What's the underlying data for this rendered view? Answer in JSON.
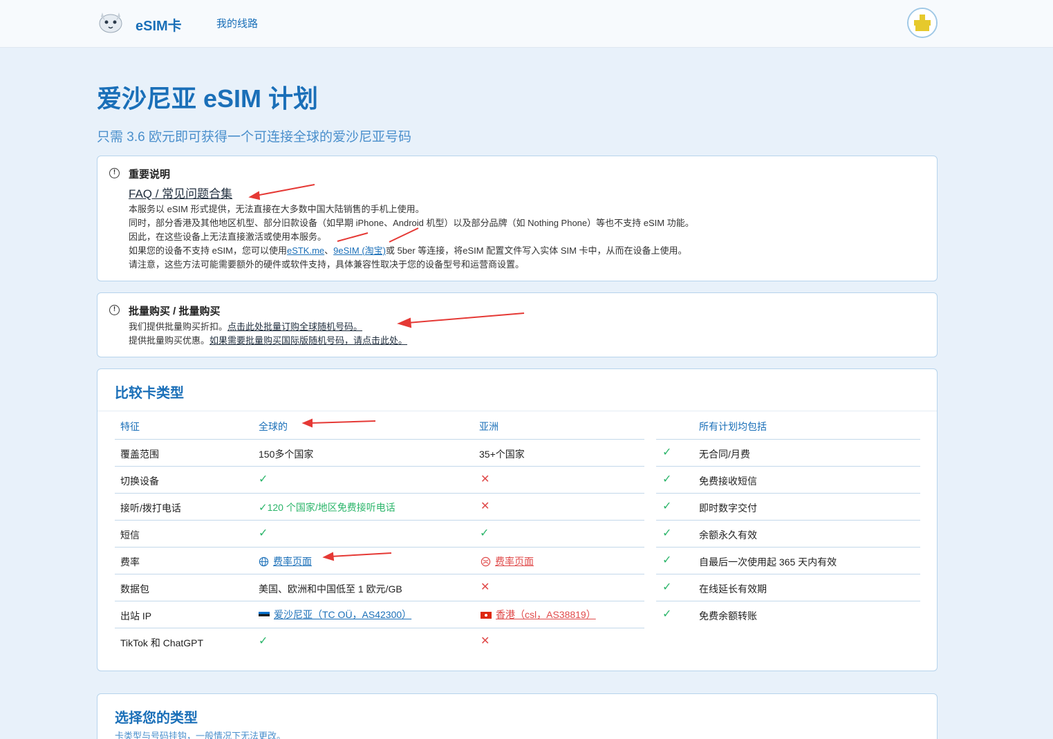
{
  "nav": {
    "brand": "eSIM卡",
    "link_my_lines": "我的线路"
  },
  "page": {
    "title": "爱沙尼亚 eSIM 计划",
    "subtitle": "只需 3.6 欧元即可获得一个可连接全球的爱沙尼亚号码"
  },
  "notice1": {
    "title": "重要说明",
    "faq": "FAQ / 常见问题合集",
    "line1": "本服务以 eSIM 形式提供，无法直接在大多数中国大陆销售的手机上使用。",
    "line2": "同时，部分香港及其他地区机型、部分旧款设备（如早期 iPhone、Android 机型）以及部分品牌（如 Nothing Phone）等也不支持 eSIM 功能。",
    "line3": "因此，在这些设备上无法直接激活或使用本服务。",
    "line4_pre": "如果您的设备不支持 eSIM，您可以使用",
    "line4_link1": "eSTK.me",
    "line4_sep": "、",
    "line4_link2": "9eSIM (淘宝)",
    "line4_post": "或 5ber 等连接，将eSIM 配置文件写入实体 SIM 卡中，从而在设备上使用。",
    "line5": "请注意，这些方法可能需要额外的硬件或软件支持，具体兼容性取决于您的设备型号和运营商设置。"
  },
  "notice2": {
    "title": "批量购买 / 批量购买",
    "line1_pre": "我们提供批量购买折扣。",
    "line1_link": "点击此处批量订购全球随机号码。",
    "line2_pre": "提供批量购买优惠。",
    "line2_link": "如果需要批量购买国际版随机号码，请点击此处。"
  },
  "compare": {
    "title": "比较卡类型",
    "headers": {
      "feature": "特征",
      "global": "全球的",
      "asia": "亚洲",
      "included": "所有计划均包括"
    },
    "rows": [
      {
        "feature": "覆盖范围",
        "global": "150多个国家",
        "asia": "35+个国家"
      },
      {
        "feature": "切换设备",
        "global": "check",
        "asia": "cross"
      },
      {
        "feature": "接听/拨打电话",
        "global": "120 个国家/地区免费接听电话",
        "asia": "cross"
      },
      {
        "feature": "短信",
        "global": "check",
        "asia": "check"
      },
      {
        "feature": "费率",
        "global": "费率页面",
        "asia": "费率页面"
      },
      {
        "feature": "数据包",
        "global": "美国、欧洲和中国低至 1 欧元/GB",
        "asia": "cross"
      },
      {
        "feature": "出站 IP",
        "global": "爱沙尼亚（TC OÜ，AS42300）",
        "asia": "香港（csl，AS38819）"
      },
      {
        "feature": "TikTok 和 ChatGPT",
        "global": "check",
        "asia": "cross"
      }
    ],
    "included": [
      "无合同/月费",
      "免费接收短信",
      "即时数字交付",
      "余额永久有效",
      "自最后一次使用起 365 天内有效",
      "在线延长有效期",
      "免费余额转账"
    ]
  },
  "choose": {
    "title": "选择您的类型",
    "subtitle": "卡类型与号码挂钩，一般情况下无法更改。"
  },
  "colors": {
    "primary": "#1a6fb8",
    "background": "#e8f1fa",
    "check": "#2bb56a",
    "cross": "#e04a4a",
    "annotation": "#e53935"
  },
  "icons": [
    "logo-icon",
    "avatar-icon",
    "info-icon",
    "check-icon",
    "cross-icon",
    "globe-icon",
    "asia-rate-icon",
    "estonia-flag-icon",
    "hongkong-flag-icon"
  ]
}
